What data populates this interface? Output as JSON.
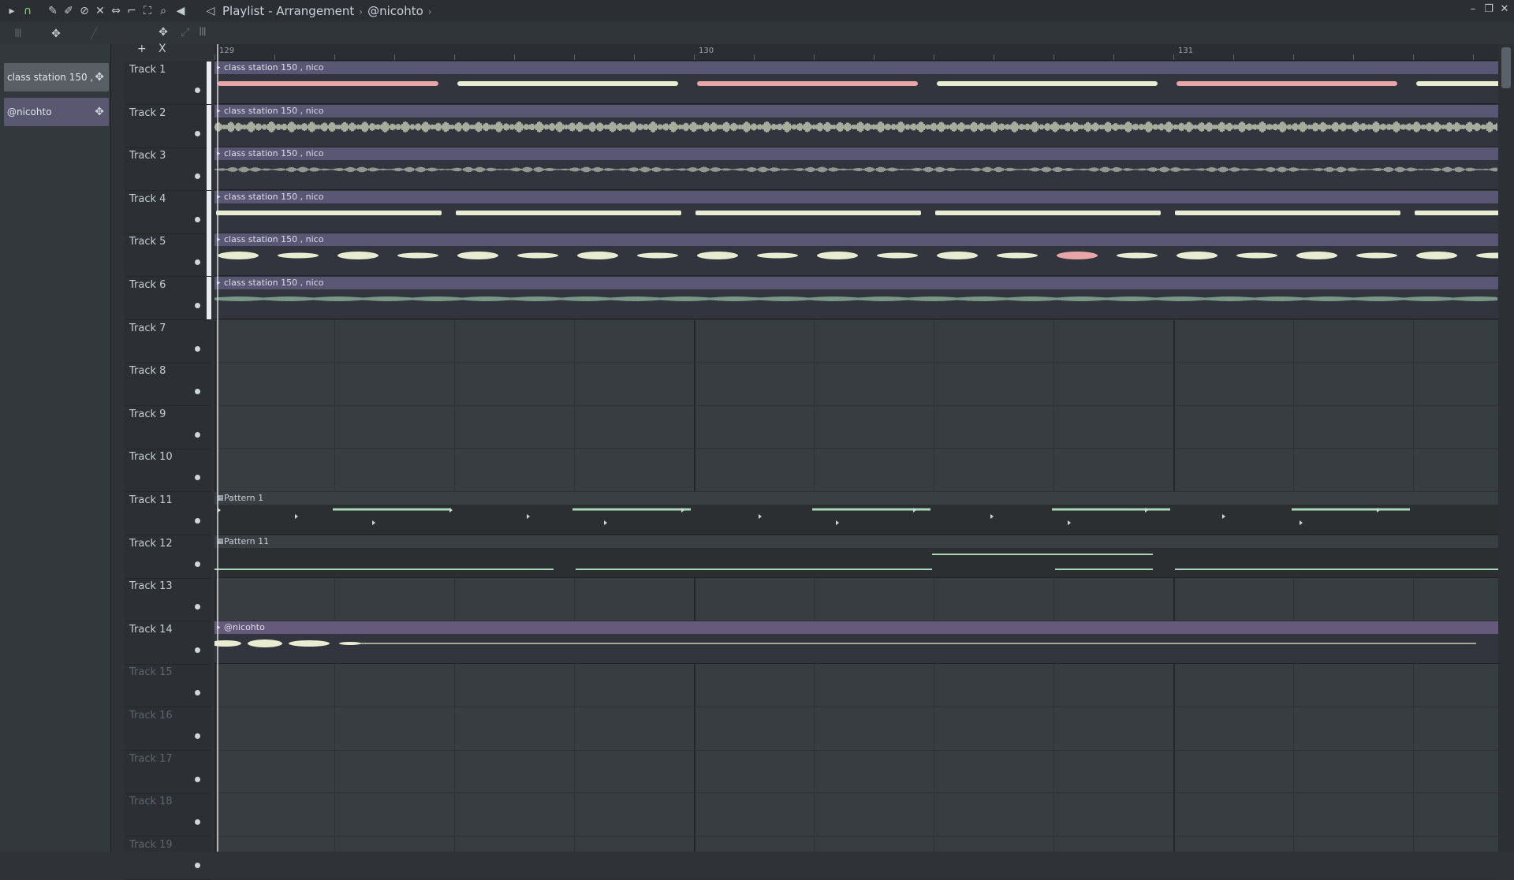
{
  "window": {
    "title": "Playlist - Arrangement",
    "pattern_name": "@nicohto",
    "separator": "›"
  },
  "toolbar_icons": [
    "arrow-icon",
    "magnet-icon",
    "pencil-icon",
    "paint-icon",
    "delete-icon",
    "mute-icon",
    "slip-icon",
    "slice-icon",
    "select-icon",
    "zoom-icon",
    "playback-icon",
    "speaker-icon"
  ],
  "clip_list": {
    "items": [
      {
        "label": "class station 150 , nico"
      },
      {
        "label": "@nicohto"
      }
    ],
    "add_label": "+",
    "close_label": "X"
  },
  "ruler": {
    "bars": [
      "129",
      "130",
      "131"
    ]
  },
  "tracks": [
    {
      "name": "Track 1"
    },
    {
      "name": "Track 2"
    },
    {
      "name": "Track 3"
    },
    {
      "name": "Track 4"
    },
    {
      "name": "Track 5"
    },
    {
      "name": "Track 6"
    },
    {
      "name": "Track 7"
    },
    {
      "name": "Track 8"
    },
    {
      "name": "Track 9"
    },
    {
      "name": "Track 10"
    },
    {
      "name": "Track 11"
    },
    {
      "name": "Track 12"
    },
    {
      "name": "Track 13"
    },
    {
      "name": "Track 14"
    },
    {
      "name": "Track 15"
    },
    {
      "name": "Track 16"
    },
    {
      "name": "Track 17"
    },
    {
      "name": "Track 18"
    },
    {
      "name": "Track 19"
    }
  ],
  "clips": [
    {
      "track": 1,
      "label": "class station 150 , nico"
    },
    {
      "track": 2,
      "label": "class station 150 , nico"
    },
    {
      "track": 3,
      "label": "class station 150 , nico"
    },
    {
      "track": 4,
      "label": "class station 150 , nico"
    },
    {
      "track": 5,
      "label": "class station 150 , nico"
    },
    {
      "track": 6,
      "label": "class station 150 , nico"
    },
    {
      "track": 11,
      "label": "Pattern 1"
    },
    {
      "track": 12,
      "label": "Pattern 11"
    },
    {
      "track": 14,
      "label": "@nicohto"
    }
  ],
  "colors": {
    "clip_header": "#5a5775",
    "wave_light": "#e8ecd0",
    "wave_red": "#e8a6a6",
    "wave_green": "#a8d8b8",
    "accent_green": "#8ad27a"
  }
}
